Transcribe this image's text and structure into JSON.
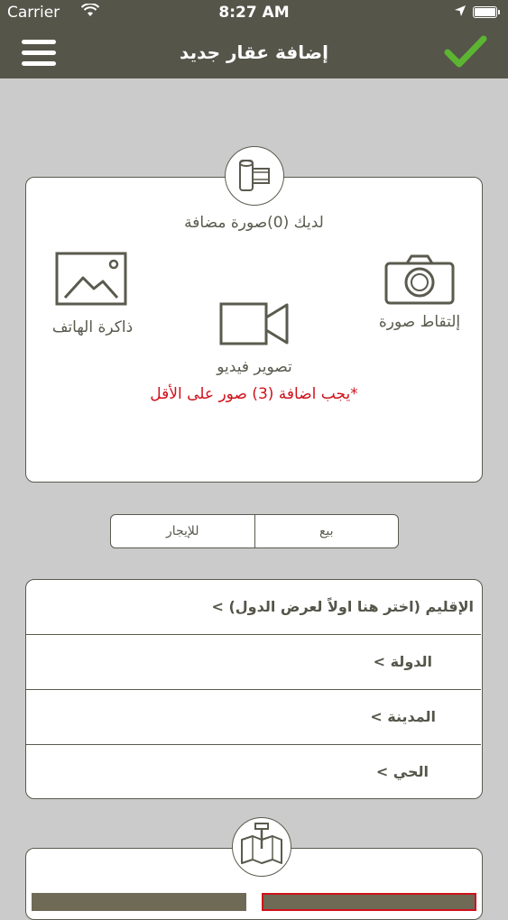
{
  "status_bar": {
    "carrier": "Carrier",
    "time": "8:27 AM"
  },
  "nav": {
    "title": "إضافة عقار جديد"
  },
  "media": {
    "photos_count": "لديك (0)صورة مضافة",
    "phone_gallery_label": "ذاكرة الهاتف",
    "take_photo_label": "إلتقاط صورة",
    "record_video_label": "تصوير فيديو",
    "min_photos_warning": "*يجب اضافة (3) صور على الأقل"
  },
  "listing_type": {
    "rent_label": "للإيجار",
    "sale_label": "بيع"
  },
  "location": {
    "region": "الإقليم (اختر هنا اولاً لعرض الدول) >",
    "country": "الدولة >",
    "city": "المدينة >",
    "district": "الحي >"
  },
  "colors": {
    "nav_bar": "#55554a",
    "background": "#cbcbcb",
    "accent_check": "#5cb531",
    "warning": "#d0121b"
  }
}
